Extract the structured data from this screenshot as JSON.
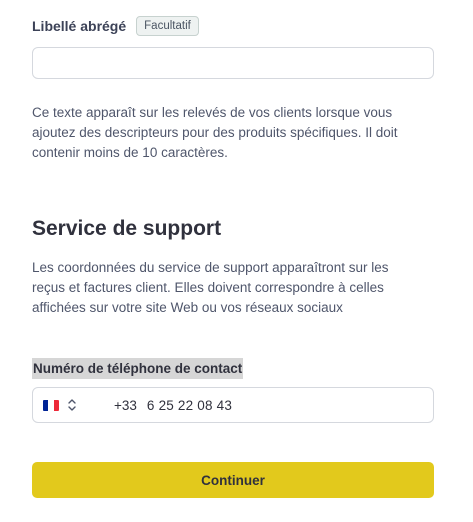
{
  "short_label": {
    "label": "Libellé abrégé",
    "badge": "Facultatif",
    "value": "",
    "help": "Ce texte apparaît sur les relevés de vos clients lorsque vous ajoutez des descripteurs pour des produits spécifiques. Il doit contenir moins de 10 caractères."
  },
  "support": {
    "title": "Service de support",
    "description": "Les coordonnées du service de support apparaîtront sur les reçus et factures client. Elles doivent correspondre à celles affichées sur votre site Web ou vos réseaux sociaux"
  },
  "phone": {
    "label": "Numéro de téléphone de contact",
    "country_icon": "flag-fr-icon",
    "dial_code": "+33",
    "number": "6 25 22 08 43"
  },
  "actions": {
    "continue_label": "Continuer"
  },
  "colors": {
    "button_bg": "#e2c91c",
    "flag_blue": "#002395",
    "flag_white": "#ffffff",
    "flag_red": "#ed2939"
  }
}
